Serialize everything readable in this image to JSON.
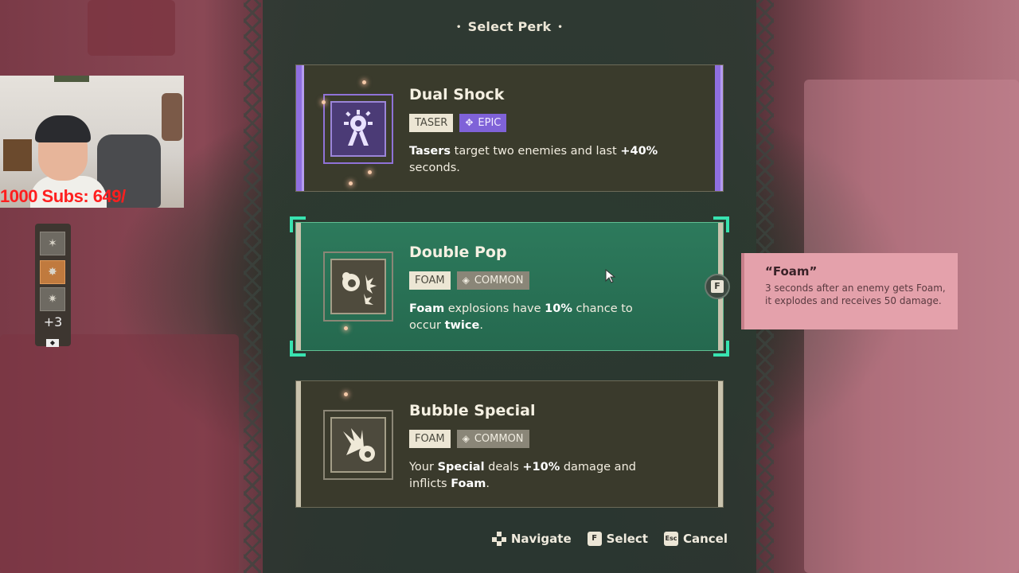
{
  "header": {
    "title": "Select Perk",
    "bullet": "•"
  },
  "perks": [
    {
      "title": "Dual Shock",
      "tag": "TASER",
      "rarity": "EPIC",
      "desc_parts": [
        "Tasers",
        " target two enemies and last ",
        "+40%",
        " seconds."
      ],
      "icon": "taser-burst-icon"
    },
    {
      "title": "Double Pop",
      "tag": "FOAM",
      "rarity": "COMMON",
      "desc_parts": [
        "Foam",
        " explosions have ",
        "10%",
        " chance to occur ",
        "twice",
        "."
      ],
      "icon": "foam-pop-icon"
    },
    {
      "title": "Bubble Special",
      "tag": "FOAM",
      "rarity": "COMMON",
      "desc_parts": [
        "Your ",
        "Special",
        " deals ",
        "+10%",
        " damage and inflicts ",
        "Foam",
        "."
      ],
      "icon": "bubble-special-icon"
    }
  ],
  "select_key": "F",
  "tooltip": {
    "title": "“Foam”",
    "body": "3 seconds after an enemy gets Foam, it explodes and receives 50 damage."
  },
  "footer": {
    "navigate": "Navigate",
    "select_key": "F",
    "select": "Select",
    "cancel_key": "Esc",
    "cancel": "Cancel"
  },
  "webcam": {
    "overlay": "1000  Subs: 649/"
  },
  "sidebar": {
    "more": "+3",
    "icons": [
      "perk-icon",
      "perk-icon",
      "perk-icon"
    ]
  },
  "colors": {
    "epic": "#8f6fe0",
    "selected": "#2d7a5c",
    "highlight": "#38e3b0",
    "tooltip": "#e4a1ab"
  }
}
